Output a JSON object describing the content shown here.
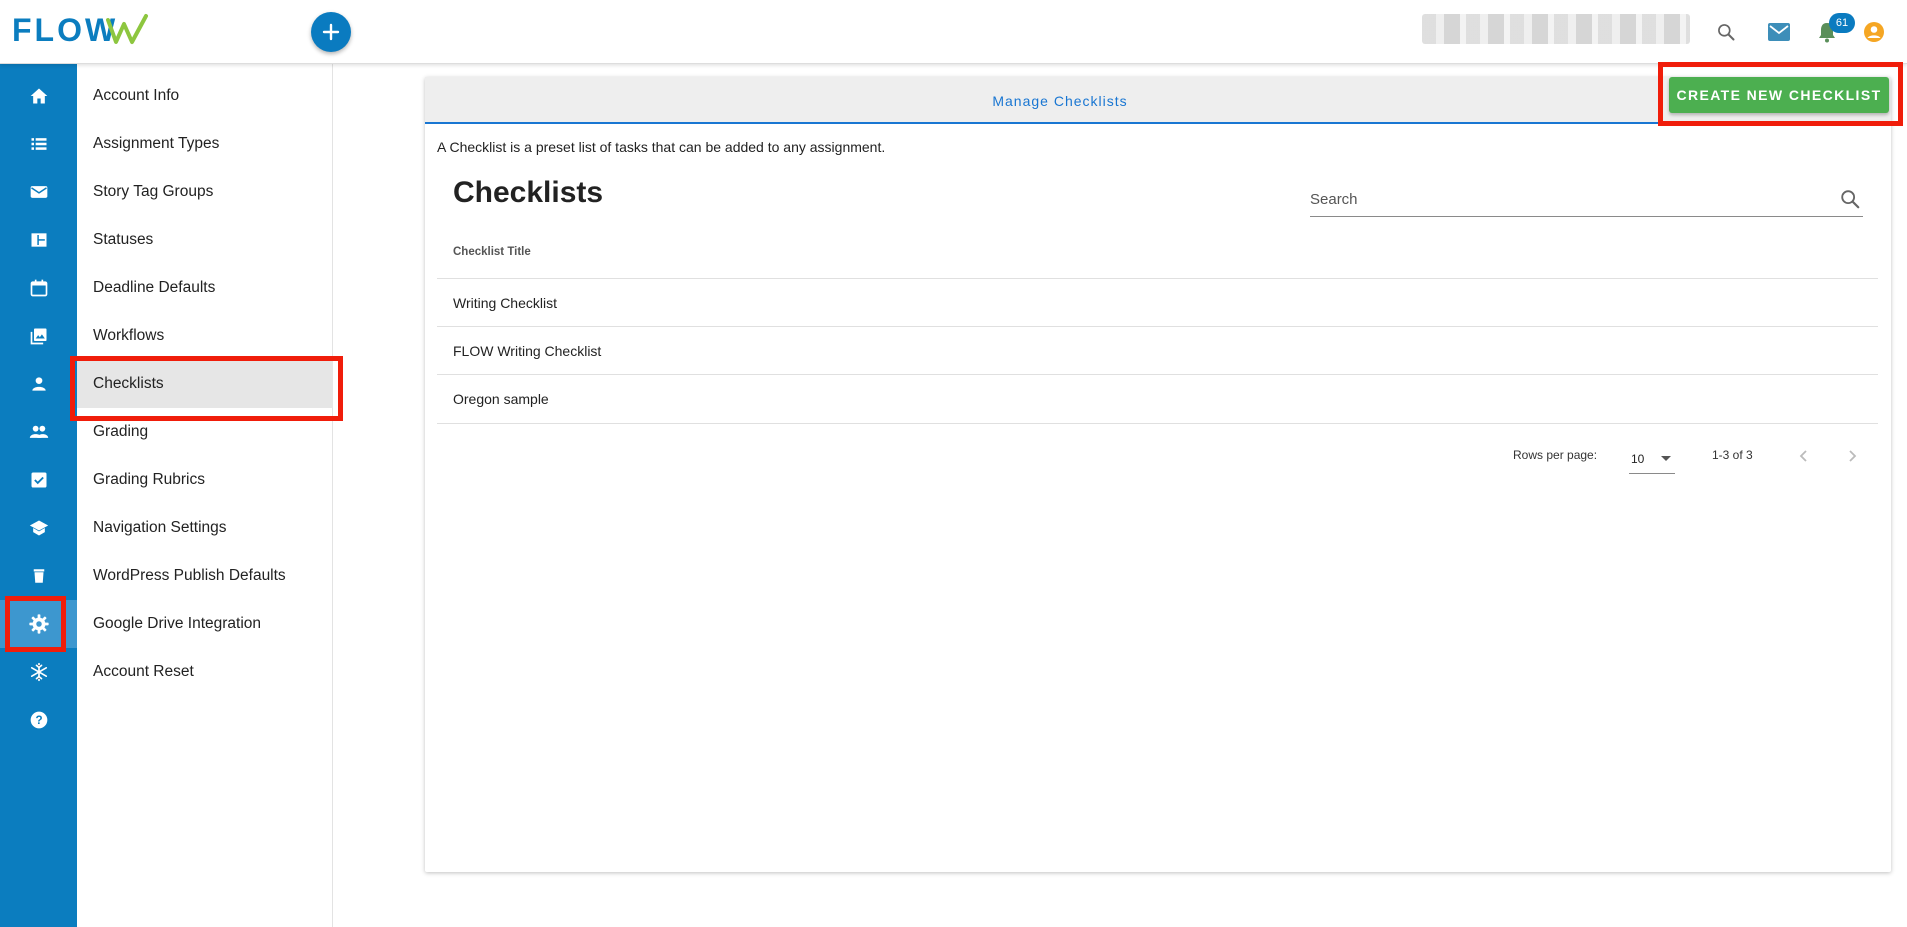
{
  "app": {
    "logo_text": "FLOW",
    "notifications_count": "61",
    "brand_color": "#0b7dbf",
    "accent_color": "#4caf50",
    "highlight_color": "#f01d0a"
  },
  "topbar": {
    "fab_icon": "plus-icon",
    "icons": [
      "search-icon",
      "mail-icon",
      "bell-icon",
      "account-circle-icon"
    ]
  },
  "rail": {
    "items": [
      {
        "icon": "home-icon",
        "active": false
      },
      {
        "icon": "list-icon",
        "active": false
      },
      {
        "icon": "mail-icon",
        "active": false
      },
      {
        "icon": "dashboard-icon",
        "active": false
      },
      {
        "icon": "calendar-icon",
        "active": false
      },
      {
        "icon": "photo-library-icon",
        "active": false
      },
      {
        "icon": "person-icon",
        "active": false
      },
      {
        "icon": "people-icon",
        "active": false
      },
      {
        "icon": "checkbox-icon",
        "active": false
      },
      {
        "icon": "school-icon",
        "active": false
      },
      {
        "icon": "trash-icon",
        "active": false
      },
      {
        "icon": "gear-icon",
        "active": true
      },
      {
        "icon": "snowflake-icon",
        "active": false
      },
      {
        "icon": "help-icon",
        "active": false
      }
    ]
  },
  "settings_nav": {
    "items": [
      {
        "label": "Account Info"
      },
      {
        "label": "Assignment Types"
      },
      {
        "label": "Story Tag Groups"
      },
      {
        "label": "Statuses"
      },
      {
        "label": "Deadline Defaults"
      },
      {
        "label": "Workflows"
      },
      {
        "label": "Checklists"
      },
      {
        "label": "Grading"
      },
      {
        "label": "Grading Rubrics"
      },
      {
        "label": "Navigation Settings"
      },
      {
        "label": "WordPress Publish Defaults"
      },
      {
        "label": "Google Drive Integration"
      },
      {
        "label": "Account Reset"
      }
    ],
    "selected": "Checklists"
  },
  "main": {
    "tab_label": "Manage Checklists",
    "create_button": "CREATE NEW CHECKLIST",
    "description": "A Checklist is a preset list of tasks that can be added to any assignment.",
    "heading": "Checklists",
    "search_placeholder": "Search",
    "table": {
      "columns": [
        "Checklist Title"
      ],
      "rows": [
        {
          "title": "Writing Checklist"
        },
        {
          "title": "FLOW Writing Checklist"
        },
        {
          "title": "Oregon sample"
        }
      ]
    },
    "pagination": {
      "rows_per_page_label": "Rows per page:",
      "rows_per_page_value": "10",
      "range_text": "1-3 of 3"
    }
  }
}
